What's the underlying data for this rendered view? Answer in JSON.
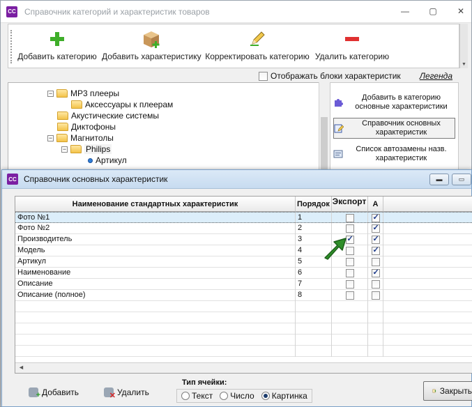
{
  "back_window": {
    "title": "Справочник категорий и характеристик товаров",
    "app_icon": "CC",
    "toolbar": [
      {
        "label": "Добавить категорию",
        "icon": "plus-icon"
      },
      {
        "label": "Добавить характеристику",
        "icon": "box-add-icon"
      },
      {
        "label": "Корректировать категорию",
        "icon": "pencil-icon"
      },
      {
        "label": "Удалить категорию",
        "icon": "minus-icon"
      }
    ],
    "show_blocks_label": "Отображать блоки характеристик",
    "show_blocks_checked": false,
    "legend_label": "Легенда",
    "tree": [
      {
        "label": "MP3 плееры"
      },
      {
        "label": "Аксессуары к плеерам"
      },
      {
        "label": "Акустические системы"
      },
      {
        "label": "Диктофоны"
      },
      {
        "label": "Магнитолы"
      },
      {
        "label": "Philips"
      },
      {
        "label": "Артикул"
      }
    ],
    "side_buttons": [
      {
        "label": "Добавить в категорию основные характеристики",
        "icon": "puzzle-icon"
      },
      {
        "label": "Справочник основных характеристик",
        "icon": "edit-list-icon"
      },
      {
        "label": "Список автозамены назв. характеристик",
        "icon": "list-icon"
      }
    ]
  },
  "dialog": {
    "title": "Справочник основных характеристик",
    "app_icon": "CC",
    "columns": {
      "name": "Наименование стандартных характеристик",
      "order": "Порядок",
      "export": "Экспорт",
      "a": "А"
    },
    "rows": [
      {
        "name": "Фото №1",
        "order": "1",
        "export": false,
        "a": true
      },
      {
        "name": "Фото №2",
        "order": "2",
        "export": false,
        "a": true
      },
      {
        "name": "Производитель",
        "order": "3",
        "export": true,
        "a": true
      },
      {
        "name": "Модель",
        "order": "4",
        "export": false,
        "a": true
      },
      {
        "name": "Артикул",
        "order": "5",
        "export": false,
        "a": false
      },
      {
        "name": "Наименование",
        "order": "6",
        "export": false,
        "a": true
      },
      {
        "name": "Описание",
        "order": "7",
        "export": false,
        "a": false
      },
      {
        "name": "Описание (полное)",
        "order": "8",
        "export": false,
        "a": false
      }
    ],
    "add_label": "Добавить",
    "delete_label": "Удалить",
    "cell_type": {
      "caption": "Тип ячейки:",
      "options": [
        "Текст",
        "Число",
        "Картинка"
      ],
      "selected": "Картинка"
    },
    "close_label": "Закрыть"
  }
}
